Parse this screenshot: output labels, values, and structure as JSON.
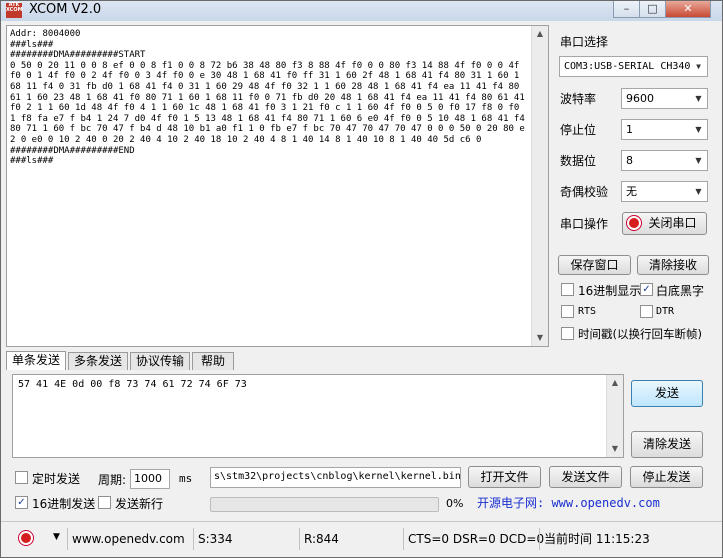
{
  "window": {
    "title": "XCOM V2.0",
    "logo_text": "ATK XCOM",
    "minimize": "–",
    "maximize": "□",
    "close": "✕"
  },
  "receive": {
    "lines": [
      "Addr: 8004000",
      "###ls###",
      "########DMA#########START",
      "0 50 0 20 11 0 0 8 ef 0 0 8 f1 0 0 8 72 b6 38 48 80 f3 8 88 4f f0 0 0 80 f3 14 88 4f f0 0 0 4f f0 0 1 4f f0 0 2 4f f0 0 3 4f f0 0 e 30 48 1 68 41 f0 ff 31 1 60 2f 48 1 68 41 f4 80 31 1 60 1 68 11 f4 0 31 fb d0 1 68 41 f4 0 31 1 60 29 48 4f f0 32 1 1 60 28 48 1 68 41 f4 ea 11 41 f4 80 61 1 60 23 48 1 68 41 f0 80 71 1 60 1 68 11 f0 0 71 fb d0 20 48 1 68 41 f4 ea 11 41 f4 80 61 41 f0 2 1 1 60 1d 48 4f f0 4 1 1 60 1c 48 1 68 41 f0 3 1 21 f0 c 1 1 60 4f f0 0 5 0 f0 17 f8 0 f0 1 f8 fa e7 f b4 1 24 7 d0 4f f0 1 5 13 48 1 68 41 f4 80 71 1 60 6 e0 4f f0 0 5 10 48 1 68 41 f4 80 71 1 60 f bc 70 47 f b4 d 48 10 b1 a0 f1 1 0 fb e7 f bc 70 47 70 47 70 47 0 0 0 50 0 20 80 e2 0 e0 0 10 2 40 0 20 2 40 4 10 2 40 18 10 2 40 4 8 1 40 14 8 1 40 10 8 1 40 40 5d c6 0",
      "########DMA#########END",
      "###ls###"
    ]
  },
  "settings": {
    "port_label": "串口选择",
    "port_value": "COM3:USB-SERIAL CH340",
    "baud_label": "波特率",
    "baud_value": "9600",
    "stop_label": "停止位",
    "stop_value": "1",
    "data_label": "数据位",
    "data_value": "8",
    "parity_label": "奇偶校验",
    "parity_value": "无",
    "op_label": "串口操作",
    "op_button": "关闭串口",
    "save_window": "保存窗口",
    "clear_receive": "清除接收",
    "hex_display": "16进制显示",
    "white_black": "白底黑字",
    "rts": "RTS",
    "dtr": "DTR",
    "timestamp": "时间戳(以换行回车断帧)"
  },
  "tabs": [
    "单条发送",
    "多条发送",
    "协议传输",
    "帮助"
  ],
  "send": {
    "text": "57 41 4E 0d 00 f8 73 74 61 72 74 6F 73",
    "send_button": "发送",
    "clear_send": "清除发送"
  },
  "bottom": {
    "timed_send": "定时发送",
    "period_label": "周期:",
    "period_value": "1000",
    "period_unit": "ms",
    "file_path": "s\\stm32\\projects\\cnblog\\kernel\\kernel.bin",
    "open_file": "打开文件",
    "send_file": "发送文件",
    "stop_send": "停止发送",
    "hex_send": "16进制发送",
    "send_newline": "发送新行",
    "progress": "0%",
    "progress_value": 0,
    "website": "开源电子网: www.openedv.com"
  },
  "status": {
    "url": "www.openedv.com",
    "sent": "S:334",
    "received": "R:844",
    "lines": "CTS=0 DSR=0 DCD=0",
    "time": "当前时间 11:15:23"
  },
  "colors": {
    "website": "#1a2fd0",
    "close_dot": "#d61e1e"
  }
}
